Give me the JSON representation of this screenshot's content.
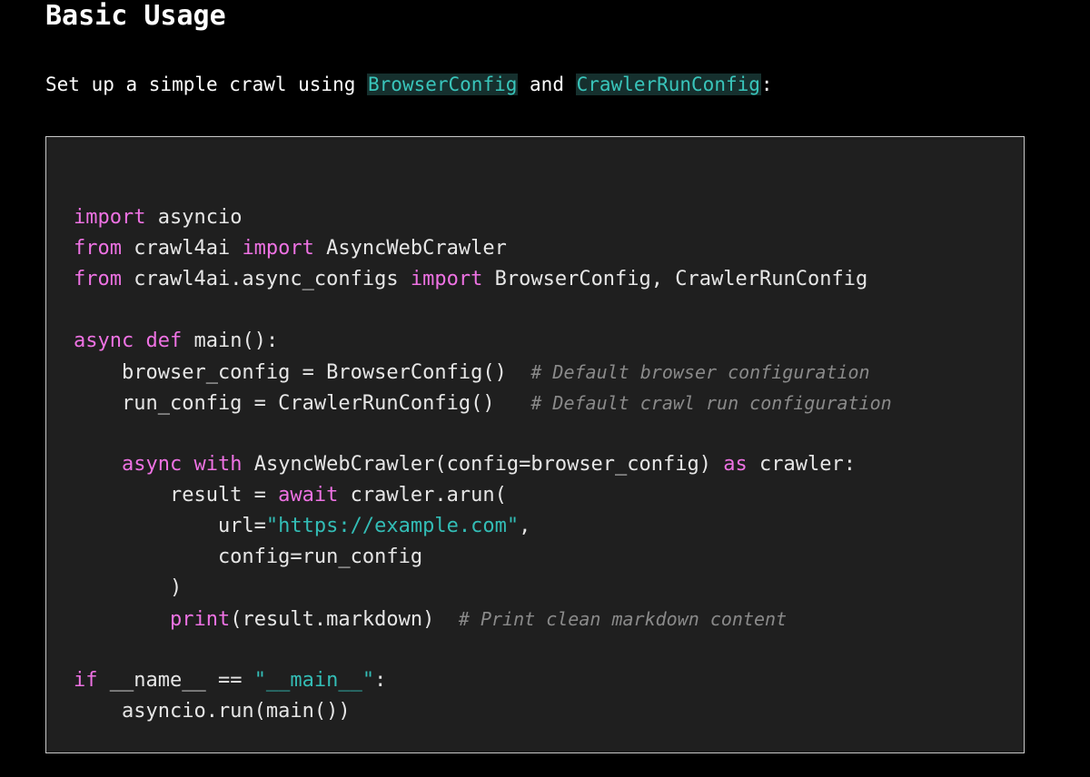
{
  "heading": "Basic Usage",
  "intro": {
    "before": "Set up a simple crawl using ",
    "code1": "BrowserConfig",
    "middle": " and ",
    "code2": "CrawlerRunConfig",
    "after": ":"
  },
  "code_lines": [
    [
      [
        "kw",
        "import"
      ],
      [
        "txt",
        " asyncio"
      ]
    ],
    [
      [
        "kw",
        "from"
      ],
      [
        "txt",
        " crawl4ai "
      ],
      [
        "kw",
        "import"
      ],
      [
        "txt",
        " AsyncWebCrawler"
      ]
    ],
    [
      [
        "kw",
        "from"
      ],
      [
        "txt",
        " crawl4ai.async_configs "
      ],
      [
        "kw",
        "import"
      ],
      [
        "txt",
        " BrowserConfig, CrawlerRunConfig"
      ]
    ],
    [],
    [
      [
        "kw",
        "async"
      ],
      [
        "txt",
        " "
      ],
      [
        "kw",
        "def"
      ],
      [
        "txt",
        " main():"
      ]
    ],
    [
      [
        "txt",
        "    browser_config = BrowserConfig()  "
      ],
      [
        "cmt",
        "# Default browser configuration"
      ]
    ],
    [
      [
        "txt",
        "    run_config = CrawlerRunConfig()   "
      ],
      [
        "cmt",
        "# Default crawl run configuration"
      ]
    ],
    [],
    [
      [
        "txt",
        "    "
      ],
      [
        "kw",
        "async"
      ],
      [
        "txt",
        " "
      ],
      [
        "kw",
        "with"
      ],
      [
        "txt",
        " AsyncWebCrawler(config=browser_config) "
      ],
      [
        "kw",
        "as"
      ],
      [
        "txt",
        " crawler:"
      ]
    ],
    [
      [
        "txt",
        "        result = "
      ],
      [
        "kw",
        "await"
      ],
      [
        "txt",
        " crawler.arun("
      ]
    ],
    [
      [
        "txt",
        "            url="
      ],
      [
        "str",
        "\"https://example.com\""
      ],
      [
        "txt",
        ","
      ]
    ],
    [
      [
        "txt",
        "            config=run_config"
      ]
    ],
    [
      [
        "txt",
        "        )"
      ]
    ],
    [
      [
        "txt",
        "        "
      ],
      [
        "kw",
        "print"
      ],
      [
        "txt",
        "(result.markdown)  "
      ],
      [
        "cmt",
        "# Print clean markdown content"
      ]
    ],
    [],
    [
      [
        "kw",
        "if"
      ],
      [
        "txt",
        " __name__ == "
      ],
      [
        "str",
        "\"__main__\""
      ],
      [
        "txt",
        ":"
      ]
    ],
    [
      [
        "txt",
        "    asyncio.run(main())"
      ]
    ]
  ]
}
